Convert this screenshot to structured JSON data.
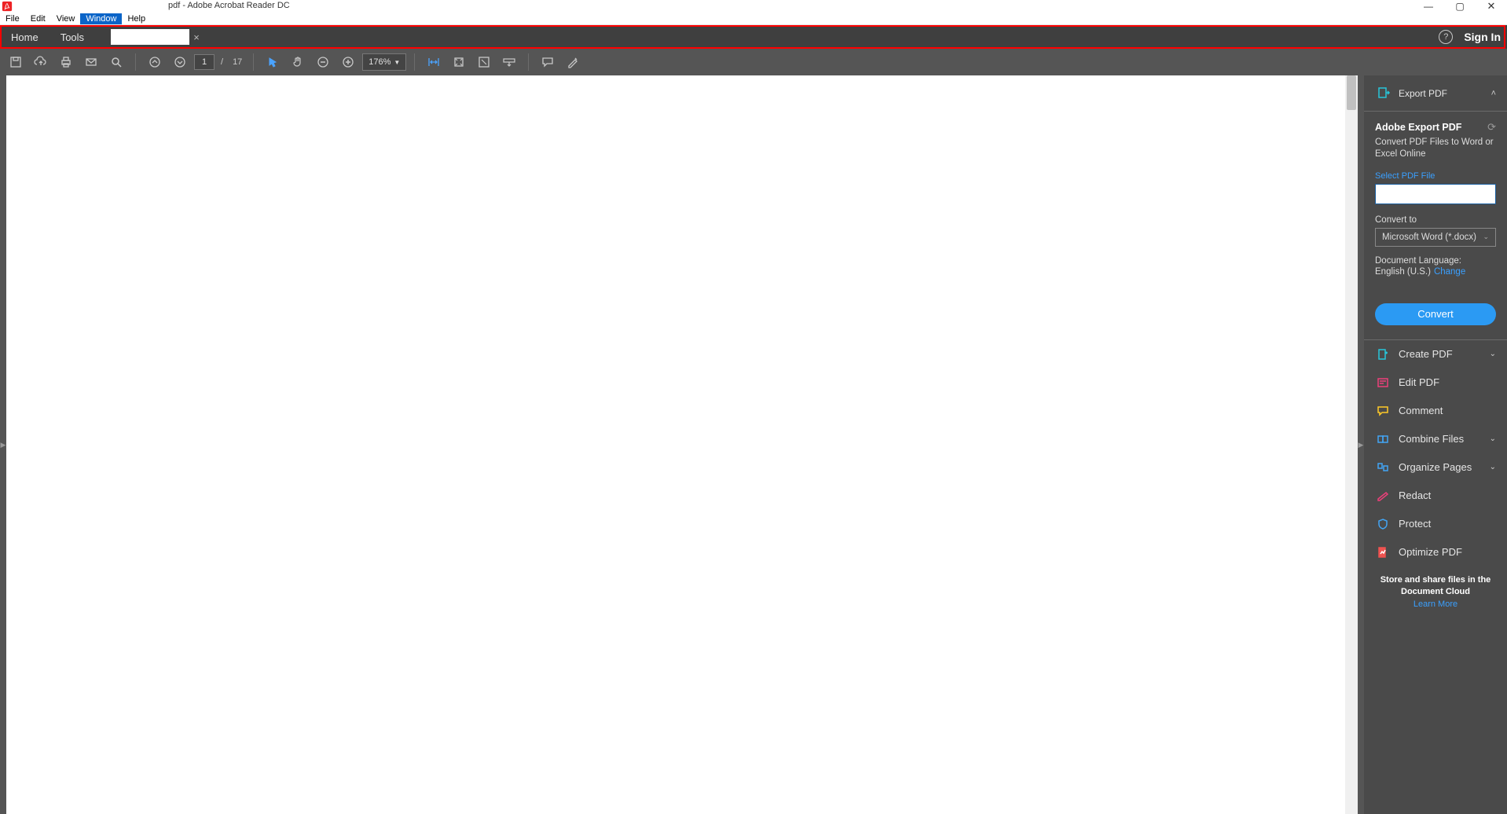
{
  "titlebar": {
    "title": "pdf - Adobe Acrobat Reader DC"
  },
  "menubar": {
    "items": [
      "File",
      "Edit",
      "View",
      "Window",
      "Help"
    ],
    "highlighted_index": 3
  },
  "tabbar": {
    "home": "Home",
    "tools": "Tools",
    "doc_tab": "",
    "signin": "Sign In"
  },
  "toolbar": {
    "page_current": "1",
    "page_sep": "/",
    "page_total": "17",
    "zoom": "176%"
  },
  "rpanel": {
    "export": {
      "header": "Export PDF",
      "title": "Adobe Export PDF",
      "desc": "Convert PDF Files to Word or Excel Online",
      "select_label": "Select PDF File",
      "convert_to_label": "Convert to",
      "convert_to_value": "Microsoft Word (*.docx)",
      "lang_label": "Document Language:",
      "lang_value": "English (U.S.)",
      "change": "Change",
      "convert_btn": "Convert"
    },
    "tools": [
      {
        "label": "Create PDF",
        "chevron": true
      },
      {
        "label": "Edit PDF",
        "chevron": false
      },
      {
        "label": "Comment",
        "chevron": false
      },
      {
        "label": "Combine Files",
        "chevron": true
      },
      {
        "label": "Organize Pages",
        "chevron": true
      },
      {
        "label": "Redact",
        "chevron": false
      },
      {
        "label": "Protect",
        "chevron": false
      },
      {
        "label": "Optimize PDF",
        "chevron": false
      }
    ],
    "footer": "Store and share files in the Document Cloud",
    "learn": "Learn More"
  }
}
